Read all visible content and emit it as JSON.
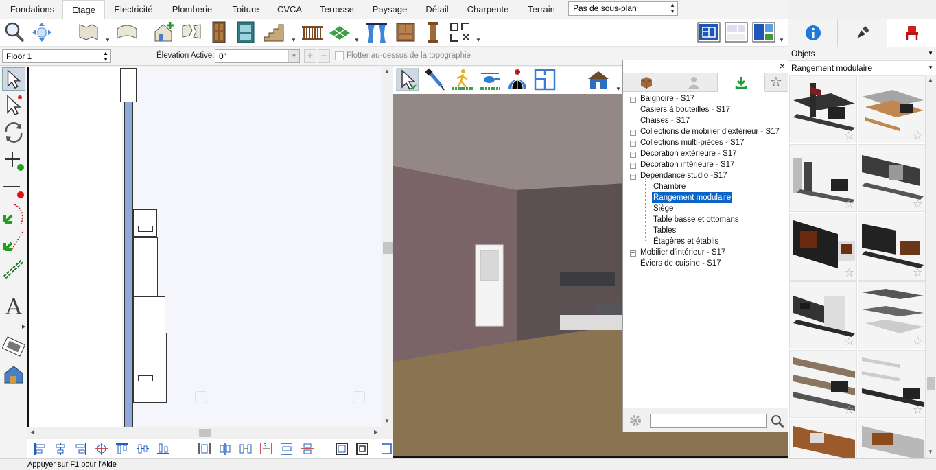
{
  "tabs": [
    "Fondations",
    "Etage",
    "Electricité",
    "Plomberie",
    "Toiture",
    "CVCA",
    "Terrasse",
    "Paysage",
    "Détail",
    "Charpente",
    "Terrain"
  ],
  "active_tab": "Etage",
  "plan_dropdown": "Pas de sous-plan",
  "floor_select": "Floor 1",
  "elevation_label": "Élevation Active:",
  "elevation_value": "0\"",
  "float_label": "Flotter au-dessus de la topographie",
  "library": {
    "tree": [
      {
        "label": "Baignoire - S17",
        "expander": "+"
      },
      {
        "label": "Casiers à bouteilles - S17",
        "expander": ""
      },
      {
        "label": "Chaises - S17",
        "expander": ""
      },
      {
        "label": "Collections de mobilier d'extérieur - S17",
        "expander": "+"
      },
      {
        "label": "Collections multi-pièces - S17",
        "expander": "+"
      },
      {
        "label": "Décoration extérieure - S17",
        "expander": "+"
      },
      {
        "label": "Décoration intérieure - S17",
        "expander": "+"
      },
      {
        "label": "Dépendance studio -S17",
        "expander": "−"
      },
      {
        "label": "Chambre",
        "expander": "",
        "child": true
      },
      {
        "label": "Rangement modulaire",
        "expander": "",
        "child": true,
        "selected": true
      },
      {
        "label": "Siège",
        "expander": "",
        "child": true
      },
      {
        "label": "Table basse et ottomans",
        "expander": "",
        "child": true
      },
      {
        "label": "Tables",
        "expander": "",
        "child": true
      },
      {
        "label": "Étagères et établis",
        "expander": "",
        "child": true
      },
      {
        "label": "Mobilier d'intérieur - S17",
        "expander": "+"
      },
      {
        "label": "Éviers de cuisine - S17",
        "expander": ""
      }
    ],
    "close": "×",
    "search_placeholder": ""
  },
  "right_panel": {
    "objets_label": "Objets",
    "category_select": "Rangement modulaire",
    "star": "☆",
    "thumbnail_count": 12
  },
  "status_text": "Appuyer sur F1 pour l'Aide",
  "colors": {
    "accent": "#0a64c8",
    "wall": "#8fa9d8",
    "floor": "#8a7350"
  }
}
